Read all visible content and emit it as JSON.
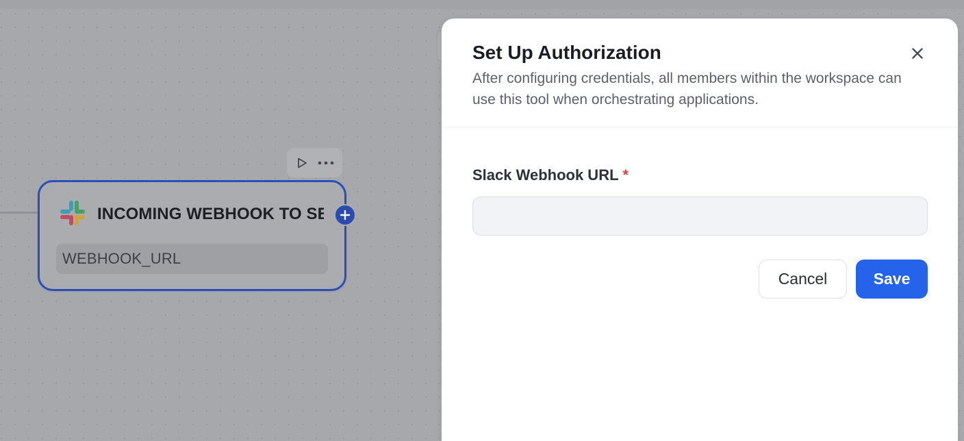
{
  "node": {
    "title": "INCOMING WEBHOOK TO SE",
    "field": "WEBHOOK_URL",
    "icon": "slack-logo"
  },
  "node_toolbar": {
    "run_icon": "play-icon",
    "more_icon": "more-horizontal-icon"
  },
  "modal": {
    "title": "Set Up Authorization",
    "description": "After configuring credentials, all members within the workspace can use this tool when orchestrating applications.",
    "close_icon": "close-icon",
    "field_label": "Slack Webhook URL",
    "required_mark": "*",
    "field_value": "",
    "cancel_label": "Cancel",
    "save_label": "Save"
  },
  "colors": {
    "primary": "#2563eb",
    "node_border": "#2b4fb7",
    "required": "#d64545",
    "overlay": "#a7a8ac"
  }
}
